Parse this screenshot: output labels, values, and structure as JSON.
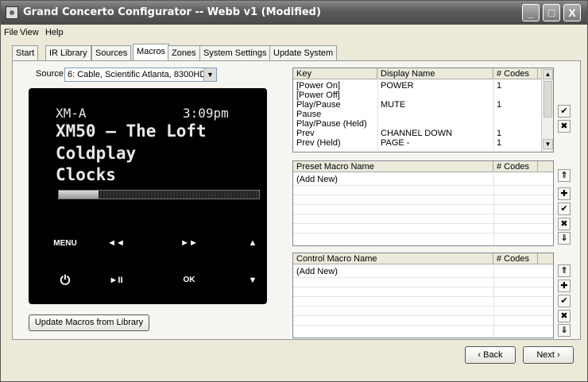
{
  "window": {
    "title": "Grand Concerto Configurator -- Webb v1 (Modified)",
    "minimize": "_",
    "maximize": "□",
    "close": "X"
  },
  "menu": [
    "File",
    "View",
    "Help"
  ],
  "tabs": [
    "Start",
    "IR Library",
    "Sources",
    "Macros",
    "Zones",
    "System Settings",
    "Update System"
  ],
  "active_tab": "Macros",
  "source": {
    "label": "Source:",
    "value": "6: Cable, Scientific Atlanta, 8300HD",
    "arrow": "▼"
  },
  "remote": {
    "station": "XM-A",
    "time": "3:09pm",
    "channel": "XM50 — The Loft",
    "artist": "Coldplay",
    "song": "Clocks",
    "progress": 0.2,
    "buttons": [
      "MENU",
      "◄◄",
      "►►",
      "▲",
      "⏻",
      "►II",
      "OK",
      "▼"
    ]
  },
  "update_button": "Update Macros from Library",
  "key_table": {
    "headers": [
      "Key",
      "Display Name",
      "# Codes"
    ],
    "rows": [
      [
        "[Power On]",
        "POWER",
        "1"
      ],
      [
        "[Power Off]",
        "",
        ""
      ],
      [
        "Play/Pause",
        "MUTE",
        "1"
      ],
      [
        "Pause",
        "",
        ""
      ],
      [
        "Play/Pause (Held)",
        "",
        ""
      ],
      [
        "Prev",
        "CHANNEL DOWN",
        "1"
      ],
      [
        "Prev (Held)",
        "PAGE -",
        "1"
      ]
    ]
  },
  "preset_table": {
    "headers": [
      "Preset Macro Name",
      "# Codes"
    ],
    "rows": [
      [
        "(Add New)",
        ""
      ]
    ]
  },
  "control_table": {
    "headers": [
      "Control Macro Name",
      "# Codes"
    ],
    "rows": [
      [
        "(Add New)",
        ""
      ]
    ]
  },
  "side_buttons": {
    "accept": "✔",
    "cancel": "✖",
    "up": "⇑",
    "add": "✚",
    "down": "⇓"
  },
  "nav": {
    "back": "‹ Back",
    "next": "Next ›"
  },
  "colors": {
    "titlebar": "#5a5a5a",
    "window_bg": "#ece9d8",
    "remote_bg": "#000000"
  }
}
